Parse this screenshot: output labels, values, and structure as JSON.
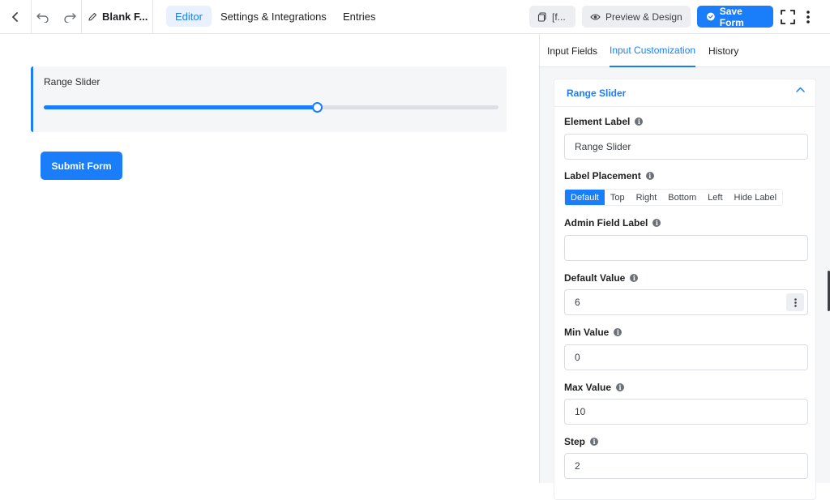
{
  "topbar": {
    "back_icon": "‹",
    "undo_icon": "↶",
    "redo_icon": "↷",
    "form_title": "Blank F...",
    "tabs": [
      {
        "label": "Editor",
        "active": true
      },
      {
        "label": "Settings & Integrations",
        "active": false
      },
      {
        "label": "Entries",
        "active": false
      }
    ],
    "shortcode_label": "[f...",
    "preview_label": "Preview & Design",
    "save_label": "Save Form"
  },
  "canvas": {
    "field_label": "Range Slider",
    "slider": {
      "min": 0,
      "max": 10,
      "value": 6
    },
    "submit_label": "Submit Form"
  },
  "panel": {
    "tabs": [
      {
        "label": "Input Fields",
        "active": false
      },
      {
        "label": "Input Customization",
        "active": true
      },
      {
        "label": "History",
        "active": false
      }
    ],
    "card_title": "Range Slider",
    "element_label": {
      "label": "Element Label",
      "value": "Range Slider"
    },
    "label_placement": {
      "label": "Label Placement",
      "options": [
        "Default",
        "Top",
        "Right",
        "Bottom",
        "Left",
        "Hide Label"
      ],
      "selected": "Default"
    },
    "admin_field_label": {
      "label": "Admin Field Label",
      "value": ""
    },
    "default_value": {
      "label": "Default Value",
      "value": "6"
    },
    "min_value": {
      "label": "Min Value",
      "value": "0"
    },
    "max_value": {
      "label": "Max Value",
      "value": "10"
    },
    "step": {
      "label": "Step",
      "value": "2"
    }
  },
  "colors": {
    "accent": "#1a7efb"
  }
}
